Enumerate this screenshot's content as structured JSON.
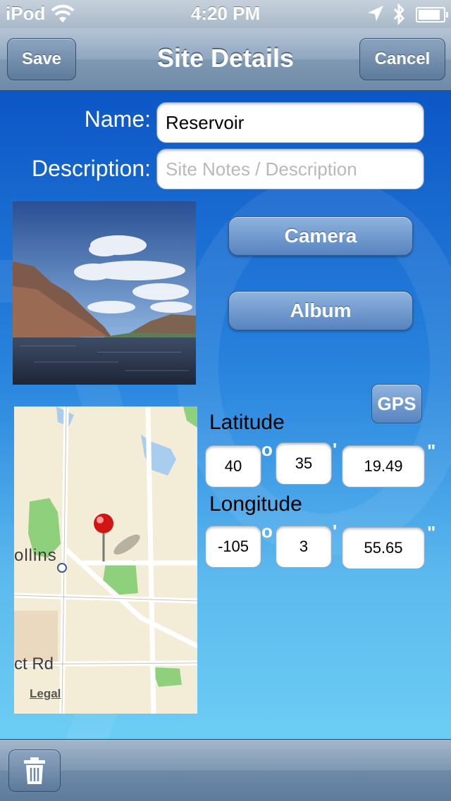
{
  "status_bar": {
    "carrier": "iPod",
    "time": "4:20 PM"
  },
  "nav": {
    "title": "Site Details",
    "save_label": "Save",
    "cancel_label": "Cancel"
  },
  "form": {
    "name_label": "Name:",
    "name_value": "Reservoir",
    "description_label": "Description:",
    "description_placeholder": "Site Notes / Description"
  },
  "photo_buttons": {
    "camera_label": "Camera",
    "album_label": "Album"
  },
  "map": {
    "label_city": "ollins",
    "label_road": "ct Rd",
    "legal": "Legal"
  },
  "gps": {
    "button_label": "GPS",
    "latitude_label": "Latitude",
    "latitude": {
      "degrees": "40",
      "minutes": "35",
      "seconds": "19.49"
    },
    "longitude_label": "Longitude",
    "longitude": {
      "degrees": "-105",
      "minutes": "3",
      "seconds": "55.65"
    },
    "degree_symbol": "o",
    "minute_symbol": "'",
    "second_symbol": "\""
  },
  "toolbar": {
    "trash_icon": "trash-icon"
  },
  "colors": {
    "background_top": "#0c56c6",
    "background_bottom": "#6ccdf4",
    "button_blue": "#5784bf",
    "nav_bar": "#8fa6bf"
  }
}
